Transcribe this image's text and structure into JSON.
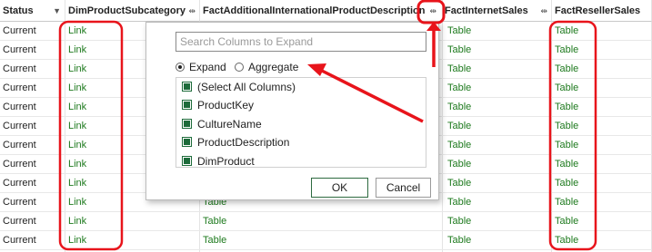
{
  "columns": [
    {
      "label": "Status",
      "control": "▼"
    },
    {
      "label": "DimProductSubcategory",
      "control": "⇹"
    },
    {
      "label": "FactAdditionalInternationalProductDescription",
      "control": "⇹"
    },
    {
      "label": "FactInternetSales",
      "control": "⇹"
    },
    {
      "label": "FactResellerSales",
      "control": ""
    }
  ],
  "rows": [
    [
      "Current",
      "Link",
      "",
      "Table",
      "Table"
    ],
    [
      "Current",
      "Link",
      "",
      "Table",
      "Table"
    ],
    [
      "Current",
      "Link",
      "",
      "Table",
      "Table"
    ],
    [
      "Current",
      "Link",
      "",
      "Table",
      "Table"
    ],
    [
      "Current",
      "Link",
      "",
      "Table",
      "Table"
    ],
    [
      "Current",
      "Link",
      "",
      "Table",
      "Table"
    ],
    [
      "Current",
      "Link",
      "",
      "Table",
      "Table"
    ],
    [
      "Current",
      "Link",
      "",
      "Table",
      "Table"
    ],
    [
      "Current",
      "Link",
      "",
      "Table",
      "Table"
    ],
    [
      "Current",
      "Link",
      "Table",
      "Table",
      "Table"
    ],
    [
      "Current",
      "Link",
      "Table",
      "Table",
      "Table"
    ],
    [
      "Current",
      "Link",
      "Table",
      "Table",
      "Table"
    ]
  ],
  "dialog": {
    "search_placeholder": "Search Columns to Expand",
    "option_expand": "Expand",
    "option_aggregate": "Aggregate",
    "selected_option": "Expand",
    "columns_list": [
      "(Select All Columns)",
      "ProductKey",
      "CultureName",
      "ProductDescription",
      "DimProduct"
    ],
    "ok_label": "OK",
    "cancel_label": "Cancel"
  },
  "colors": {
    "link_text": "#1e7a1e",
    "checkbox": "#1d6b3a",
    "annotation": "#e8141b"
  }
}
